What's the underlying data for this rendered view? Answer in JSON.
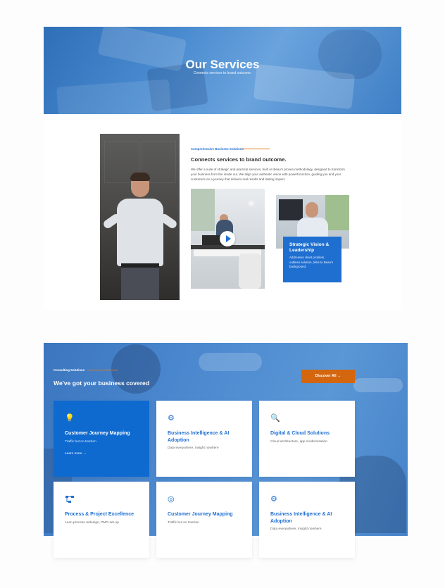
{
  "hero": {
    "title": "Our Services",
    "subtitle": "Connects services to brand outcome."
  },
  "intro": {
    "eyebrow": "Comprehensive Business Solutions",
    "title": "Connects services to brand outcome.",
    "body": "We offer a suite of strategic and practical services, built on Beau's proven methodology, designed to transform your business from the inside out. We align your authentic vision with powerful action, guiding you and your customers on a journey that delivers real results and lasting impact.",
    "vision_card": {
      "title": "Strategic Vision & Leadership",
      "body": "Addresses client problem, outlines solution, links to Beau's background."
    }
  },
  "services": {
    "eyebrow": "Consulting Solutions",
    "title": "We've got your business covered",
    "discover_label": "Discover All →",
    "cards": [
      {
        "icon": "lightbulb-icon",
        "title": "Customer Journey Mapping",
        "subtitle": "Traffic but no traction",
        "link": "Learn more →",
        "active": true
      },
      {
        "icon": "team-gear-icon",
        "title": "Business Intelligence & AI Adoption",
        "subtitle": "Data everywhere, insight nowhere",
        "active": false
      },
      {
        "icon": "document-search-icon",
        "title": "Digital & Cloud Solutions",
        "subtitle": "Cloud architecture, app modernisation",
        "active": false
      },
      {
        "icon": "workflow-icon",
        "title": "Process & Project Excellence",
        "subtitle": "Lean process redesign, PMO set-up",
        "active": false
      },
      {
        "icon": "target-icon",
        "title": "Customer Journey Mapping",
        "subtitle": "Traffic but no traction",
        "active": false
      },
      {
        "icon": "gear-icon",
        "title": "Business Intelligence & AI Adoption",
        "subtitle": "Data everywhere, insight nowhere",
        "active": false
      }
    ]
  },
  "colors": {
    "accent_blue": "#1f6fd1",
    "accent_orange": "#d4660f"
  }
}
